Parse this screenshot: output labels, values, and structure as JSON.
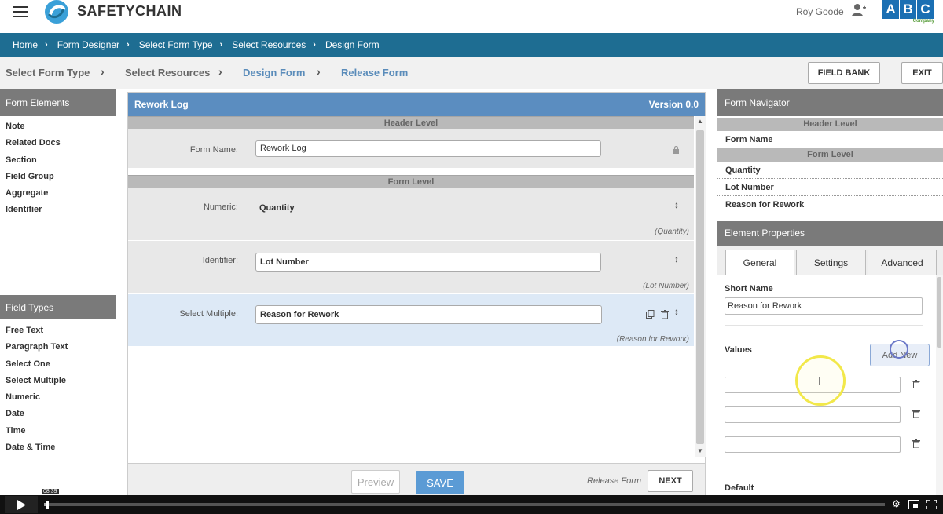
{
  "header": {
    "logo_text": "SAFETYCHAIN",
    "user_name": "Roy Goode",
    "company_letters": [
      "A",
      "B",
      "C"
    ],
    "company_sub": "Company"
  },
  "breadcrumb": [
    "Home",
    "Form Designer",
    "Select Form Type",
    "Select Resources",
    "Design Form"
  ],
  "steps": {
    "items": [
      "Select Form Type",
      "Select Resources",
      "Design Form",
      "Release Form"
    ],
    "field_bank_label": "FIELD BANK",
    "exit_label": "EXIT"
  },
  "left": {
    "form_elements_title": "Form Elements",
    "form_elements": [
      "Note",
      "Related Docs",
      "Section",
      "Field Group",
      "Aggregate",
      "Identifier"
    ],
    "field_types_title": "Field Types",
    "field_types": [
      "Free Text",
      "Paragraph Text",
      "Select One",
      "Select Multiple",
      "Numeric",
      "Date",
      "Time",
      "Date & Time"
    ]
  },
  "designer": {
    "title": "Rework Log",
    "version": "Version 0.0",
    "header_level": "Header Level",
    "form_name_label": "Form Name:",
    "form_name_value": "Rework Log",
    "form_level": "Form Level",
    "rows": [
      {
        "label": "Numeric:",
        "value": "Quantity",
        "hint": "(Quantity)"
      },
      {
        "label": "Identifier:",
        "value": "Lot Number",
        "hint": "(Lot Number)"
      },
      {
        "label": "Select Multiple:",
        "value": "Reason for Rework",
        "hint": "(Reason for Rework)"
      }
    ],
    "preview_label": "Preview",
    "save_label": "SAVE",
    "release_label": "Release Form",
    "next_label": "NEXT"
  },
  "navigator": {
    "title": "Form Navigator",
    "header_level": "Header Level",
    "form_name": "Form Name",
    "form_level": "Form Level",
    "items": [
      "Quantity",
      "Lot Number",
      "Reason for Rework"
    ]
  },
  "properties": {
    "title": "Element Properties",
    "tabs": [
      "General",
      "Settings",
      "Advanced"
    ],
    "short_name_label": "Short Name",
    "short_name_value": "Reason for Rework",
    "values_label": "Values",
    "add_new_label": "Add New",
    "default_label": "Default"
  },
  "video": {
    "timecode": "08:39",
    "progress": 0.0028
  },
  "colors": {
    "brand_blue": "#1e6d92",
    "designer_head": "#5b8dc0",
    "step_active": "#5a8cba",
    "save_blue": "#5b9bd5"
  }
}
